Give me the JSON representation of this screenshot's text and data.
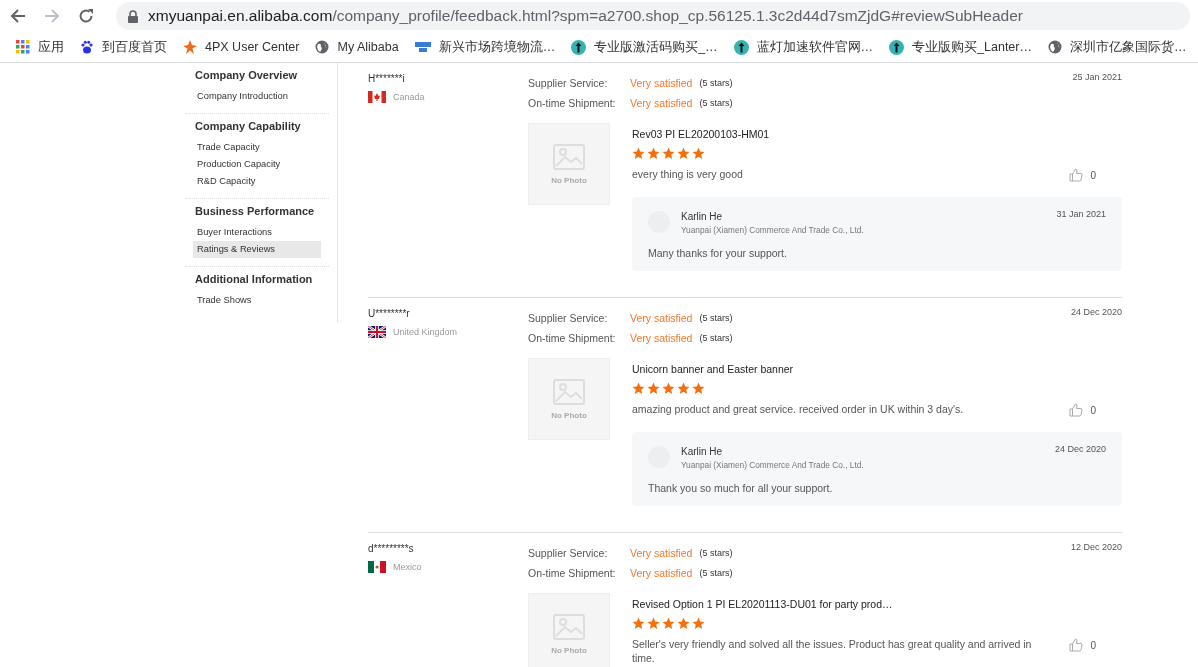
{
  "browser": {
    "url_host": "xmyuanpai.en.alibaba.com",
    "url_path": "/company_profile/feedback.html?spm=a2700.shop_cp.56125.1.3c2d44d7smZjdG#reviewSubHeader",
    "bookmarks": [
      {
        "kind": "apps",
        "label": "应用"
      },
      {
        "kind": "paw",
        "label": "到百度首页"
      },
      {
        "kind": "star",
        "label": "4PX User Center"
      },
      {
        "kind": "globe",
        "label": "My Alibaba"
      },
      {
        "kind": "jnet",
        "label": "新兴市场跨境物流…"
      },
      {
        "kind": "arrow",
        "label": "专业版激活码购买_…"
      },
      {
        "kind": "arrow",
        "label": "蓝灯加速软件官网…"
      },
      {
        "kind": "arrow",
        "label": "专业版购买_Lanter…"
      },
      {
        "kind": "globe",
        "label": "深圳市亿象国际货…"
      }
    ]
  },
  "sidebar": {
    "sections": [
      {
        "title": "Company Overview",
        "items": [
          {
            "label": "Company Introduction",
            "selected": false
          }
        ]
      },
      {
        "title": "Company Capability",
        "items": [
          {
            "label": "Trade Capacity",
            "selected": false
          },
          {
            "label": "Production Capacity",
            "selected": false
          },
          {
            "label": "R&D Capacity",
            "selected": false
          }
        ]
      },
      {
        "title": "Business Performance",
        "items": [
          {
            "label": "Buyer Interactions",
            "selected": false
          },
          {
            "label": "Ratings & Reviews",
            "selected": true
          }
        ]
      },
      {
        "title": "Additional Information",
        "items": [
          {
            "label": "Trade Shows",
            "selected": false
          }
        ]
      }
    ]
  },
  "reviews": [
    {
      "buyer": "H*******i",
      "kind": "canada",
      "country": "Canada",
      "date": "25 Jan 2021",
      "ratings": [
        {
          "label": "Supplier Service:",
          "value": "Very satisfied",
          "note": "(5 stars)"
        },
        {
          "label": "On-time Shipment:",
          "value": "Very satisfied",
          "note": "(5 stars)"
        }
      ],
      "photo_text": "No Photo",
      "product": "Rev03 PI EL20200103-HM01",
      "stars": 5,
      "comment": "every thing is very good",
      "likes": "0",
      "reply": {
        "name": "Karlin He",
        "company": "Yuanpai (Xiamen) Commerce And Trade Co., Ltd.",
        "date": "31 Jan 2021",
        "text": "Many thanks for your support."
      }
    },
    {
      "buyer": "U********r",
      "kind": "uk",
      "country": "United Kingdom",
      "date": "24 Dec 2020",
      "ratings": [
        {
          "label": "Supplier Service:",
          "value": "Very satisfied",
          "note": "(5 stars)"
        },
        {
          "label": "On-time Shipment:",
          "value": "Very satisfied",
          "note": "(5 stars)"
        }
      ],
      "photo_text": "No Photo",
      "product": "Unicorn banner and Easter banner",
      "stars": 5,
      "comment": "amazing product and great service. received order in UK within 3 day's.",
      "likes": "0",
      "reply": {
        "name": "Karlin He",
        "company": "Yuanpai (Xiamen) Commerce And Trade Co., Ltd.",
        "date": "24 Dec 2020",
        "text": "Thank you so much for all your support."
      }
    },
    {
      "buyer": "d*********s",
      "kind": "mexico",
      "country": "Mexico",
      "date": "12 Dec 2020",
      "ratings": [
        {
          "label": "Supplier Service:",
          "value": "Very satisfied",
          "note": "(5 stars)"
        },
        {
          "label": "On-time Shipment:",
          "value": "Very satisfied",
          "note": "(5 stars)"
        }
      ],
      "photo_text": "No Photo",
      "product": "Revised Option 1 PI EL20201113-DU01 for party prod…",
      "stars": 5,
      "comment": "Seller's very friendly and solved all the issues. Product has great quality and arrived in time.",
      "likes": "0"
    }
  ]
}
